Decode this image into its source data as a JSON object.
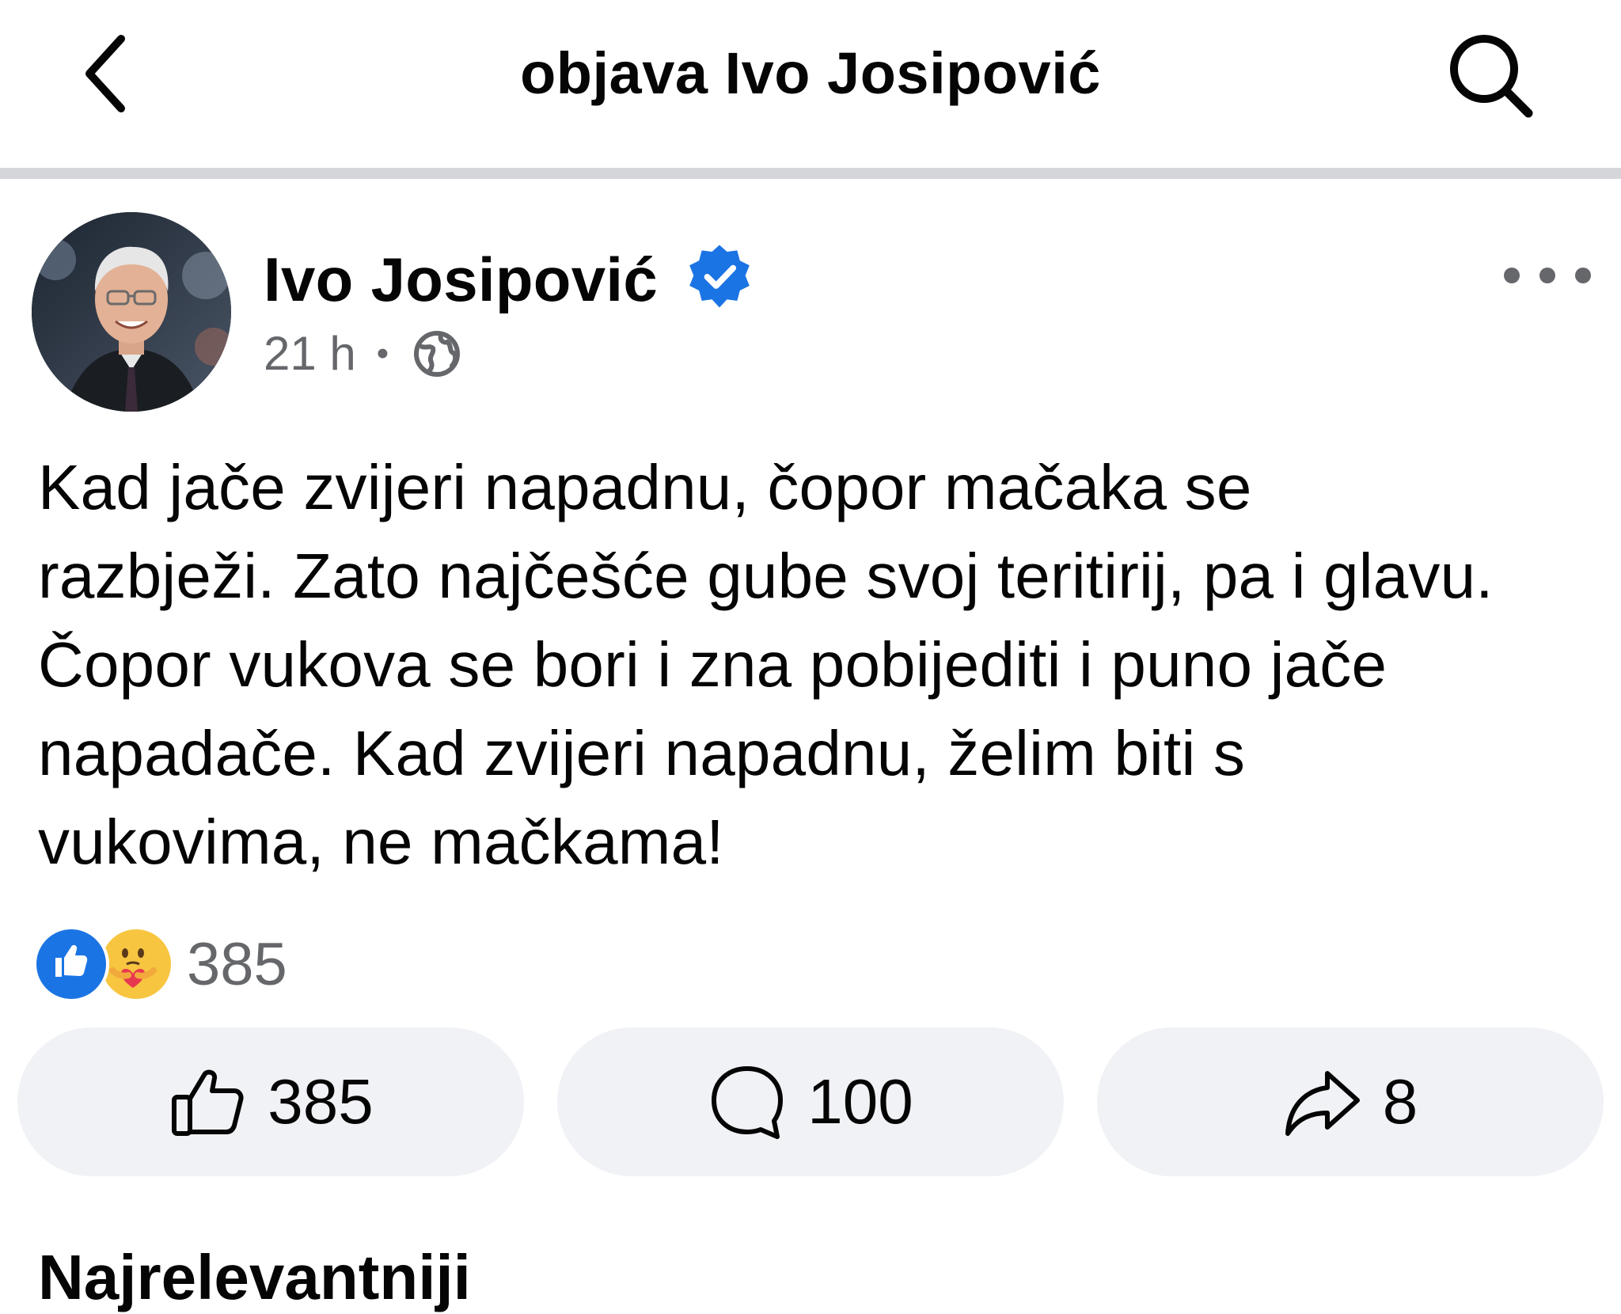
{
  "header": {
    "title": "objava Ivo Josipović",
    "back_icon": "chevron-left-icon",
    "search_icon": "search-icon"
  },
  "post": {
    "author": "Ivo Josipović",
    "verified": true,
    "time": "21 h",
    "separator": "•",
    "audience_icon": "globe-icon",
    "text": "Kad jače zvijeri napadnu, čopor mačaka se\nrazbježi. Zato najčešće gube svoj teritirij, pa i glavu.\nČopor vukova se bori i zna pobijediti i puno jače\nnapadače. Kad zvijeri napadnu, želim biti s\nvukovima, ne mačkama!",
    "reactions": {
      "types": [
        "like",
        "care"
      ],
      "count": "385"
    },
    "actions": {
      "like_count": "385",
      "comment_count": "100",
      "share_count": "8"
    }
  },
  "next_section": {
    "heading": "Najrelevantniji"
  },
  "colors": {
    "accent": "#1b74e4",
    "secondary_text": "#65676b",
    "button_bg": "#f0f2f5",
    "divider": "#d5d6da"
  }
}
